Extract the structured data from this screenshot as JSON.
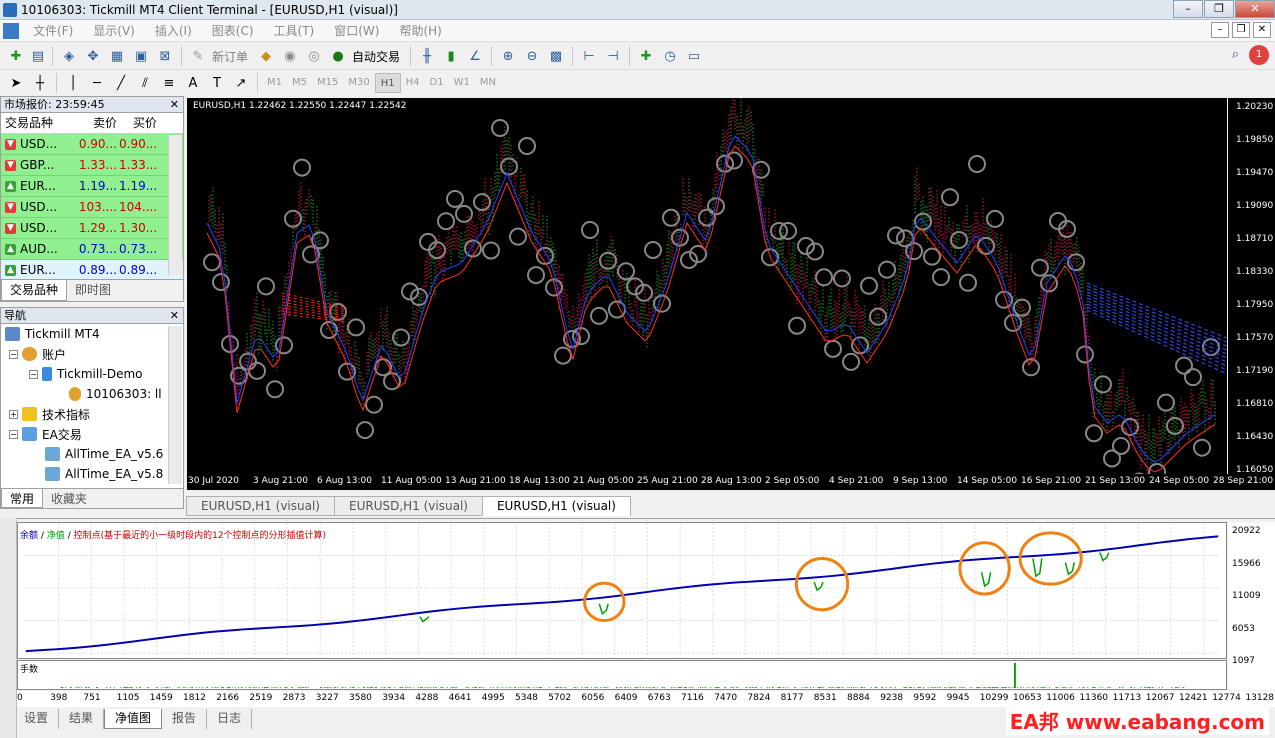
{
  "window": {
    "title": "10106303: Tickmill MT4 Client Terminal - [EURUSD,H1 (visual)]",
    "controls": [
      "–",
      "❐",
      "✕"
    ]
  },
  "menu": [
    "文件(F)",
    "显示(V)",
    "插入(I)",
    "图表(C)",
    "工具(T)",
    "窗口(W)",
    "帮助(H)"
  ],
  "toolbar": {
    "new_order": "新订单",
    "auto_trade": "自动交易",
    "timeframes": [
      "M1",
      "M5",
      "M15",
      "M30",
      "H1",
      "H4",
      "D1",
      "W1",
      "MN"
    ],
    "selected_timeframe": "H1",
    "notification_count": "1"
  },
  "market_watch": {
    "header": "市场报价: 23:59:45",
    "columns": [
      "交易品种",
      "卖价",
      "买价"
    ],
    "rows": [
      {
        "symbol": "USD...",
        "bid": "0.90...",
        "ask": "0.90...",
        "dir": "down",
        "bid_color": "#d00000"
      },
      {
        "symbol": "GBP...",
        "bid": "1.33...",
        "ask": "1.33...",
        "dir": "down",
        "bid_color": "#d00000"
      },
      {
        "symbol": "EUR...",
        "bid": "1.19...",
        "ask": "1.19...",
        "dir": "up",
        "bid_color": "#0000d0"
      },
      {
        "symbol": "USD...",
        "bid": "103....",
        "ask": "104....",
        "dir": "down",
        "bid_color": "#d00000"
      },
      {
        "symbol": "USD...",
        "bid": "1.29...",
        "ask": "1.30...",
        "dir": "down",
        "bid_color": "#d00000"
      },
      {
        "symbol": "AUD...",
        "bid": "0.73...",
        "ask": "0.73...",
        "dir": "up",
        "bid_color": "#0000d0"
      },
      {
        "symbol": "EUR...",
        "bid": "0.89...",
        "ask": "0.89...",
        "dir": "up",
        "bid_color": "#0000d0"
      }
    ],
    "tabs": [
      "交易品种",
      "即时图"
    ]
  },
  "navigator": {
    "header": "导航",
    "items": [
      "Tickmill MT4",
      "账户",
      "Tickmill-Demo",
      "10106303: ll",
      "技术指标",
      "EA交易",
      "AllTime_EA_v5.6",
      "AllTime_EA_v5.8"
    ],
    "tabs": [
      "常用",
      "收藏夹"
    ]
  },
  "chart": {
    "info": "EURUSD,H1  1.22462 1.22550 1.22447 1.22542",
    "price_labels": [
      "1.20230",
      "1.19850",
      "1.19470",
      "1.19090",
      "1.18710",
      "1.18330",
      "1.17950",
      "1.17570",
      "1.17190",
      "1.16810",
      "1.16430",
      "1.16050"
    ],
    "time_labels": [
      "30 Jul 2020",
      "3 Aug 21:00",
      "6 Aug 13:00",
      "11 Aug 05:00",
      "13 Aug 21:00",
      "18 Aug 13:00",
      "21 Aug 05:00",
      "25 Aug 21:00",
      "28 Aug 13:00",
      "2 Sep 05:00",
      "4 Sep 21:00",
      "9 Sep 13:00",
      "14 Sep 05:00",
      "16 Sep 21:00",
      "21 Sep 13:00",
      "24 Sep 05:00",
      "28 Sep 21:00"
    ],
    "tabs": [
      "EURUSD,H1 (visual)",
      "EURUSD,H1 (visual)",
      "EURUSD,H1 (visual)"
    ]
  },
  "tester": {
    "legend_balance": "余额",
    "legend_equity": "净值",
    "legend_points": "控制点(基于最近的小一级时段内的12个控制点的分形插值计算)",
    "volume_label": "手数",
    "y_labels": [
      "20922",
      "15966",
      "11009",
      "6053",
      "1097"
    ],
    "x_labels": [
      "0",
      "398",
      "751",
      "1105",
      "1459",
      "1812",
      "2166",
      "2519",
      "2873",
      "3227",
      "3580",
      "3934",
      "4288",
      "4641",
      "4995",
      "5348",
      "5702",
      "6056",
      "6409",
      "6763",
      "7116",
      "7470",
      "7824",
      "8177",
      "8531",
      "8884",
      "9238",
      "9592",
      "9945",
      "10299",
      "10653",
      "11006",
      "11360",
      "11713",
      "12067",
      "12421",
      "12774",
      "13128"
    ],
    "tabs": [
      "设置",
      "结果",
      "净值图",
      "报告",
      "日志"
    ],
    "active_tab": "净值图",
    "colors": {
      "balance": "#0000b0",
      "equity": "#00a000",
      "circle": "#f08010"
    }
  },
  "watermark": "EA邦 www.eabang.com"
}
